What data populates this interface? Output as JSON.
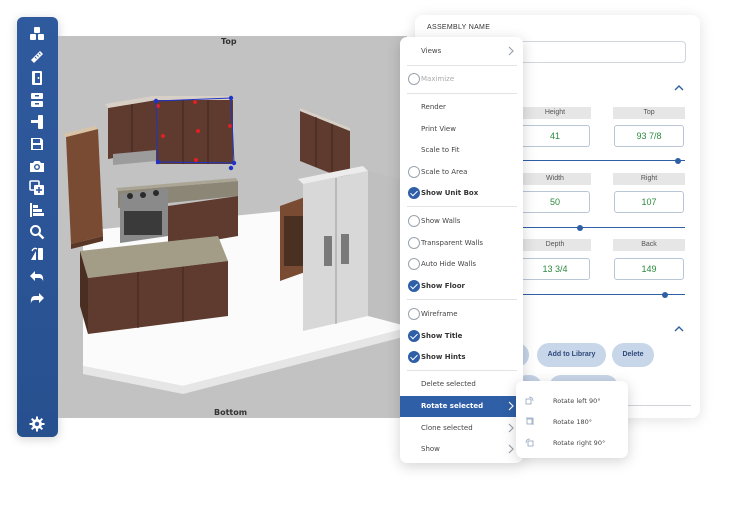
{
  "toolbar": {
    "buttons": [
      {
        "name": "cubes-icon"
      },
      {
        "name": "ruler-icon"
      },
      {
        "name": "door-icon"
      },
      {
        "name": "drawer-icon"
      },
      {
        "name": "stair-icon"
      },
      {
        "name": "save-icon"
      },
      {
        "name": "camera-icon"
      },
      {
        "name": "add-copy-icon"
      },
      {
        "name": "align-icon"
      },
      {
        "name": "zoom-icon"
      },
      {
        "name": "mirror-icon"
      },
      {
        "name": "undo-icon"
      },
      {
        "name": "redo-icon"
      }
    ],
    "settings_icon": "gear-icon",
    "accent": "#2f5a9e"
  },
  "viewport": {
    "top_label": "Top",
    "bottom_label": "Bottom",
    "background": "#c2c2c2"
  },
  "panel": {
    "title": "ASSEMBLY NAME",
    "name_value": "",
    "dims": [
      {
        "label": "Height",
        "value": "41"
      },
      {
        "label": "Top",
        "value": "93 7/8"
      },
      {
        "label": "Width",
        "value": "50"
      },
      {
        "label": "Right",
        "value": "107"
      },
      {
        "label": "Depth",
        "value": "13 3/4"
      },
      {
        "label": "Back",
        "value": "149"
      }
    ],
    "sliders": [
      0.96,
      0.37,
      0.88
    ],
    "buttons": {
      "add_to_library": "Add to Library",
      "delete": "Delete"
    },
    "value_color": "#2b8a3e"
  },
  "menu": {
    "items": [
      {
        "label": "Views",
        "kind": "arrow"
      },
      {
        "label": "Maximize",
        "kind": "radio-disabled"
      },
      {
        "label": "Render",
        "kind": "plain"
      },
      {
        "label": "Print View",
        "kind": "plain"
      },
      {
        "label": "Scale to Fit",
        "kind": "plain"
      },
      {
        "label": "Scale to Area",
        "kind": "radio"
      },
      {
        "label": "Show Unit Box",
        "kind": "checked"
      },
      {
        "label": "Show Walls",
        "kind": "radio"
      },
      {
        "label": "Transparent Walls",
        "kind": "radio"
      },
      {
        "label": "Auto Hide Walls",
        "kind": "radio"
      },
      {
        "label": "Show Floor",
        "kind": "checked"
      },
      {
        "label": "Wireframe",
        "kind": "radio"
      },
      {
        "label": "Show Title",
        "kind": "checked"
      },
      {
        "label": "Show Hints",
        "kind": "checked"
      },
      {
        "label": "Delete selected",
        "kind": "plain"
      },
      {
        "label": "Rotate selected",
        "kind": "selected"
      },
      {
        "label": "Clone selected",
        "kind": "arrow"
      },
      {
        "label": "Show",
        "kind": "arrow"
      }
    ]
  },
  "submenu": {
    "items": [
      {
        "label": "Rotate left 90°",
        "icon": "rotate-left-icon"
      },
      {
        "label": "Rotate 180°",
        "icon": "rotate-180-icon"
      },
      {
        "label": "Rotate right 90°",
        "icon": "rotate-right-icon"
      }
    ]
  }
}
